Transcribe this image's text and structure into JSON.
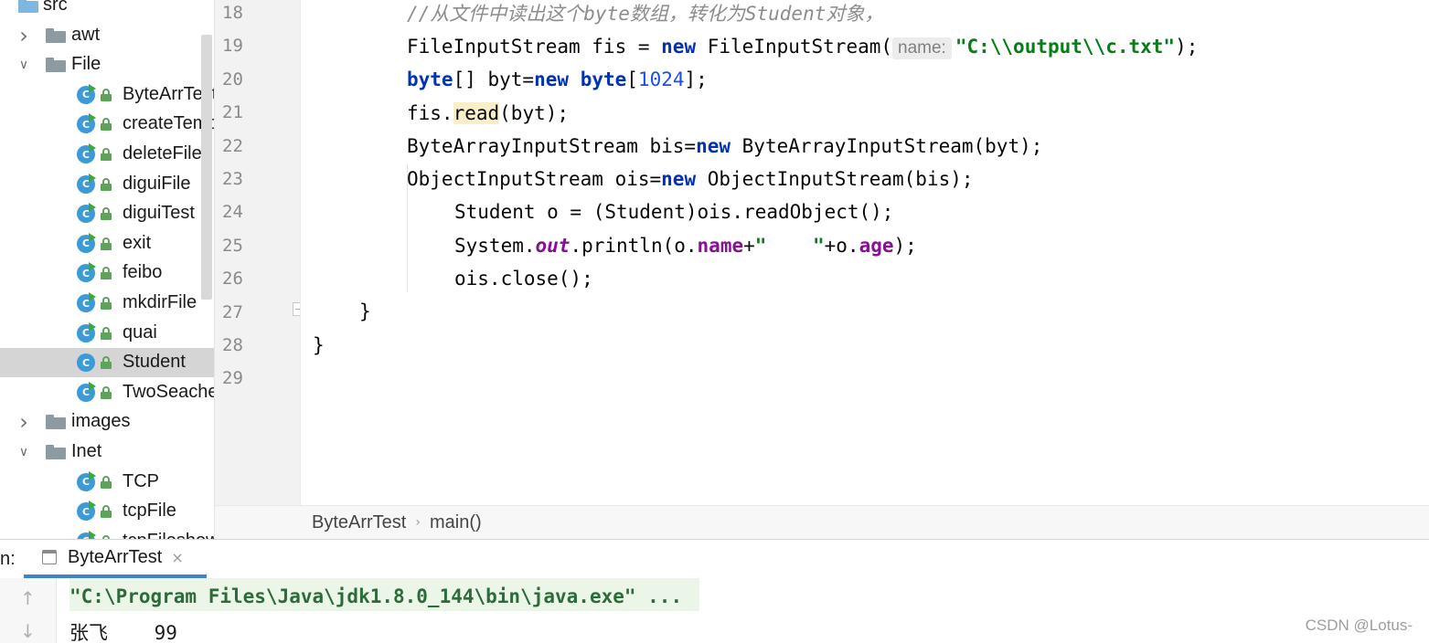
{
  "project_tree": {
    "items": [
      {
        "label": "src",
        "type": "source-root",
        "depth": 0,
        "expanded": true
      },
      {
        "label": "awt",
        "type": "package",
        "depth": 1,
        "expanded": false
      },
      {
        "label": "File",
        "type": "package",
        "depth": 1,
        "expanded": true
      },
      {
        "label": "ByteArrTest",
        "type": "class",
        "depth": 2
      },
      {
        "label": "createTemp",
        "type": "class",
        "depth": 2
      },
      {
        "label": "deleteFile",
        "type": "class",
        "depth": 2
      },
      {
        "label": "diguiFile",
        "type": "class",
        "depth": 2
      },
      {
        "label": "diguiTest",
        "type": "class",
        "depth": 2
      },
      {
        "label": "exit",
        "type": "class",
        "depth": 2
      },
      {
        "label": "feibo",
        "type": "class",
        "depth": 2
      },
      {
        "label": "mkdirFile",
        "type": "class",
        "depth": 2
      },
      {
        "label": "quai",
        "type": "class",
        "depth": 2
      },
      {
        "label": "Student",
        "type": "class",
        "depth": 2,
        "selected": true
      },
      {
        "label": "TwoSeacher",
        "type": "class",
        "depth": 2
      },
      {
        "label": "images",
        "type": "package",
        "depth": 1,
        "expanded": false
      },
      {
        "label": "Inet",
        "type": "package",
        "depth": 1,
        "expanded": true
      },
      {
        "label": "TCP",
        "type": "class",
        "depth": 2
      },
      {
        "label": "tcpFile",
        "type": "class",
        "depth": 2
      },
      {
        "label": "tcpFileshow",
        "type": "class",
        "depth": 2
      }
    ]
  },
  "editor": {
    "line_numbers": [
      "18",
      "19",
      "20",
      "21",
      "22",
      "23",
      "24",
      "25",
      "26",
      "27",
      "28",
      "29"
    ],
    "code": {
      "l18": "//从文件中读出这个byte数组，转化为Student对象，",
      "l19_a": "FileInputStream fis = ",
      "l19_kw": "new",
      "l19_b": " FileInputStream(",
      "l19_hint": "name:",
      "l19_str": "\"C:\\\\output\\\\c.txt\"",
      "l19_c": ");",
      "l20_kw1": "byte",
      "l20_a": "[] byt=",
      "l20_kw2": "new",
      "l20_sp": " ",
      "l20_kw3": "byte",
      "l20_b": "[",
      "l20_num": "1024",
      "l20_c": "];",
      "l21_a": "fis.",
      "l21_hl": "read",
      "l21_b": "(byt);",
      "l22_a": "ByteArrayInputStream bis=",
      "l22_kw": "new",
      "l22_b": " ByteArrayInputStream(byt);",
      "l23_a": "ObjectInputStream ois=",
      "l23_kw": "new",
      "l23_b": " ObjectInputStream(bis);",
      "l24": "Student o = (Student)ois.readObject();",
      "l25_a": "System.",
      "l25_static": "out",
      "l25_b": ".println(o.",
      "l25_f1": "name",
      "l25_c": "+",
      "l25_str": "\"    \"",
      "l25_d": "+o.",
      "l25_f2": "age",
      "l25_e": ");",
      "l26": "ois.close();",
      "l27": "}",
      "l28": "}"
    }
  },
  "breadcrumb": {
    "items": [
      "ByteArrTest",
      "main()"
    ],
    "separator": "›"
  },
  "run_panel": {
    "label": "n:",
    "tab_label": "ByteArrTest",
    "tab_close": "×",
    "console": {
      "command": "\"C:\\Program Files\\Java\\jdk1.8.0_144\\bin\\java.exe\" ...",
      "output": "张飞    99"
    },
    "toolbar": {
      "up": "↑",
      "down": "↓"
    }
  },
  "watermark": "CSDN @Lotus-"
}
